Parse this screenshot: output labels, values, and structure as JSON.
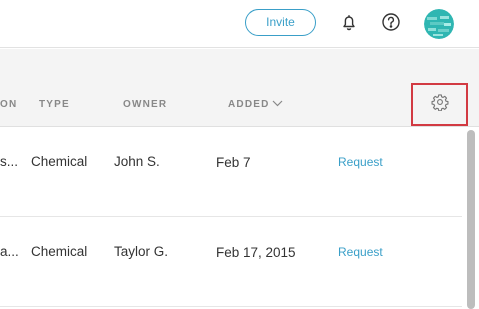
{
  "topbar": {
    "invite_label": "Invite",
    "icons": {
      "bell": "bell-icon",
      "help": "help-icon",
      "avatar": "avatar"
    }
  },
  "table": {
    "columns": {
      "partial_left": "ON",
      "type": "TYPE",
      "owner": "OWNER",
      "added": "ADDED"
    },
    "settings_icon": "gear-icon",
    "highlight_color": "#d23a42",
    "rows": [
      {
        "name": "s...",
        "type": "Chemical",
        "owner": "John S.",
        "added": "Feb 7",
        "action": "Request"
      },
      {
        "name": "a...",
        "type": "Chemical",
        "owner": "Taylor G.",
        "added": "Feb 17, 2015",
        "action": "Request"
      }
    ]
  },
  "colors": {
    "accent": "#3a9fc8",
    "header_bg": "#f4f4f4"
  }
}
